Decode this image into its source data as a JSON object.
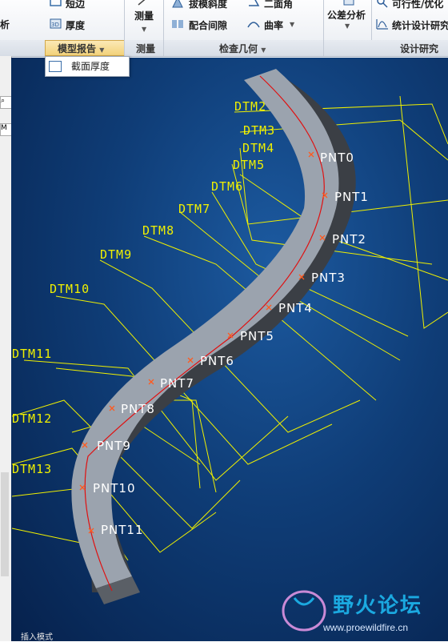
{
  "ribbon": {
    "items": {
      "analysis_left": "析",
      "trim": "短边",
      "thickness": "厚度",
      "measure": "测量",
      "draft": "拔模斜度",
      "clearance": "配合间隙",
      "dihedral": "二面角",
      "curvature": "曲率",
      "tolerance": "公差分析",
      "feasibility": "可行性/优化",
      "stat_design": "统计设计研究"
    },
    "groups": {
      "model_report": "模型报告",
      "measure": "测量",
      "inspect_geometry": "检查几何",
      "design_study": "设计研究"
    }
  },
  "dropdown": {
    "item": "截面厚度"
  },
  "viewport": {
    "datums": [
      "DTM2",
      "DTM3",
      "DTM4",
      "DTM5",
      "DTM6",
      "DTM7",
      "DTM8",
      "DTM9",
      "DTM10",
      "DTM11",
      "DTM12",
      "DTM13"
    ],
    "points": [
      "PNT0",
      "PNT1",
      "PNT2",
      "PNT3",
      "PNT4",
      "PNT5",
      "PNT6",
      "PNT7",
      "PNT8",
      "PNT9",
      "PNT10",
      "PNT11"
    ],
    "mode_text": "插入模式"
  },
  "watermark": {
    "title": "野火论坛",
    "url": "www.proewildfire.cn"
  },
  "colors": {
    "datum": "#f0f000",
    "curve": "#e01010",
    "body": "#9ba3ae",
    "background": "#0f3d77"
  }
}
